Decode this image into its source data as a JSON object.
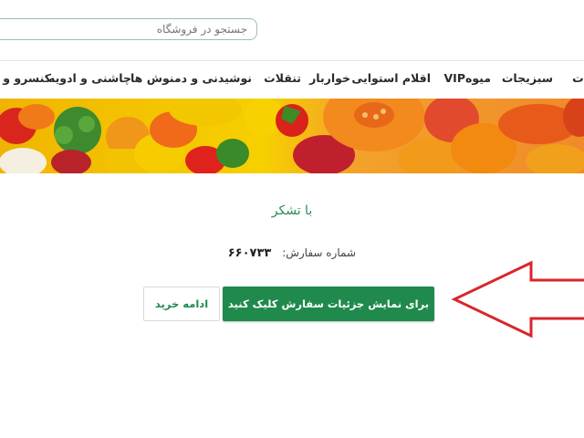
{
  "search": {
    "placeholder": "جستجو در فروشگاه"
  },
  "nav": {
    "items": [
      "ات",
      "سبزیجات",
      "میوه",
      "VIP",
      "اقلام استوایی",
      "خواربار",
      "تنقلات",
      "نوشیدنی و دمنوش ها",
      "چاشنی و ادویه",
      "کنسرو و غ"
    ]
  },
  "banner": {
    "description_icon": "fruit-vegetable-banner"
  },
  "content": {
    "thanks_text": "با تشکر",
    "order_label": "شماره سفارش:",
    "order_number": "۶۶۰۷۳۳",
    "details_button": "برای نمایش جزئیات سفارش کلیک کنید",
    "continue_button": "ادامه خرید"
  },
  "colors": {
    "accent": "#1f8a4c",
    "thanks_text": "#2e8b57",
    "arrow": "#d9262b",
    "search_border": "#9bbfb0"
  }
}
